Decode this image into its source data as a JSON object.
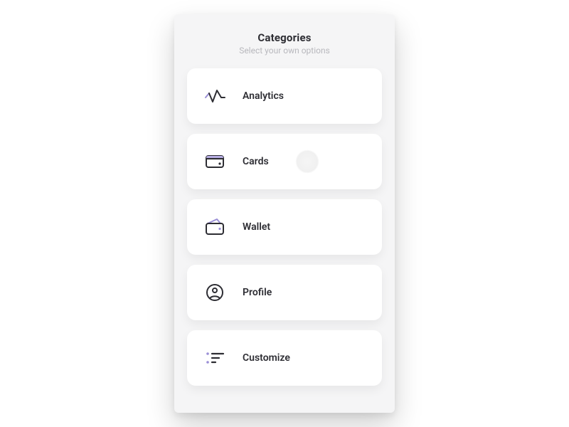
{
  "header": {
    "title": "Categories",
    "subtitle": "Select your own options"
  },
  "categories": [
    {
      "label": "Analytics"
    },
    {
      "label": "Cards"
    },
    {
      "label": "Wallet"
    },
    {
      "label": "Profile"
    },
    {
      "label": "Customize"
    }
  ],
  "colors": {
    "accent": "#9a8fd6",
    "stroke": "#2d2d33"
  }
}
